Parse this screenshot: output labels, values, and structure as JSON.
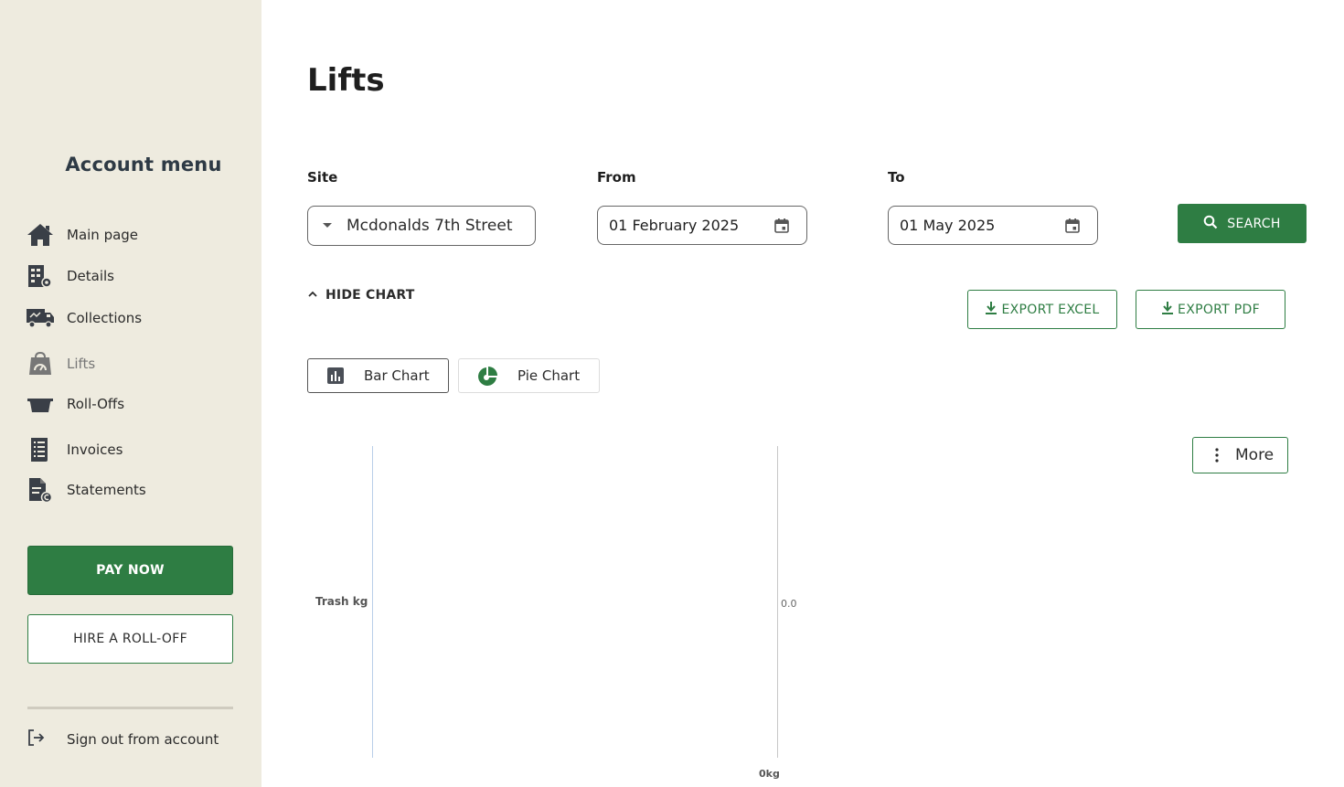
{
  "sidebar": {
    "title": "Account menu",
    "items": [
      {
        "label": "Main page",
        "icon": "home-icon"
      },
      {
        "label": "Details",
        "icon": "building-gear-icon"
      },
      {
        "label": "Collections",
        "icon": "truck-icon"
      },
      {
        "label": "Lifts",
        "icon": "bag-gauge-icon"
      },
      {
        "label": "Roll-Offs",
        "icon": "rolloff-container-icon"
      },
      {
        "label": "Invoices",
        "icon": "invoice-list-icon"
      },
      {
        "label": "Statements",
        "icon": "statement-icon"
      }
    ],
    "active_item": "Lifts",
    "pay_now_label": "PAY NOW",
    "hire_label": "HIRE A ROLL-OFF",
    "signout_label": "Sign out from account"
  },
  "page": {
    "title": "Lifts"
  },
  "filters": {
    "site_label": "Site",
    "site_value": "Mcdonalds 7th Street",
    "from_label": "From",
    "from_value": "01 February 2025",
    "to_label": "To",
    "to_value": "01 May 2025",
    "search_label": "SEARCH"
  },
  "actions": {
    "hide_chart_label": "HIDE CHART",
    "export_excel_label": "EXPORT EXCEL",
    "export_pdf_label": "EXPORT PDF",
    "bar_chart_label": "Bar Chart",
    "pie_chart_label": "Pie Chart",
    "more_label": "More"
  },
  "colors": {
    "sidebar_bg": "#eeebdf",
    "accent_green": "#2e7d43",
    "text_dark": "#2b2b2b"
  },
  "chart_data": {
    "type": "bar",
    "categories": [
      "Trash kg"
    ],
    "series": [
      {
        "values": [
          0.0
        ]
      }
    ],
    "tick_labels": [
      "0.0"
    ],
    "x_tick_label": "0kg",
    "title": "",
    "xlabel": "",
    "ylabel": ""
  }
}
